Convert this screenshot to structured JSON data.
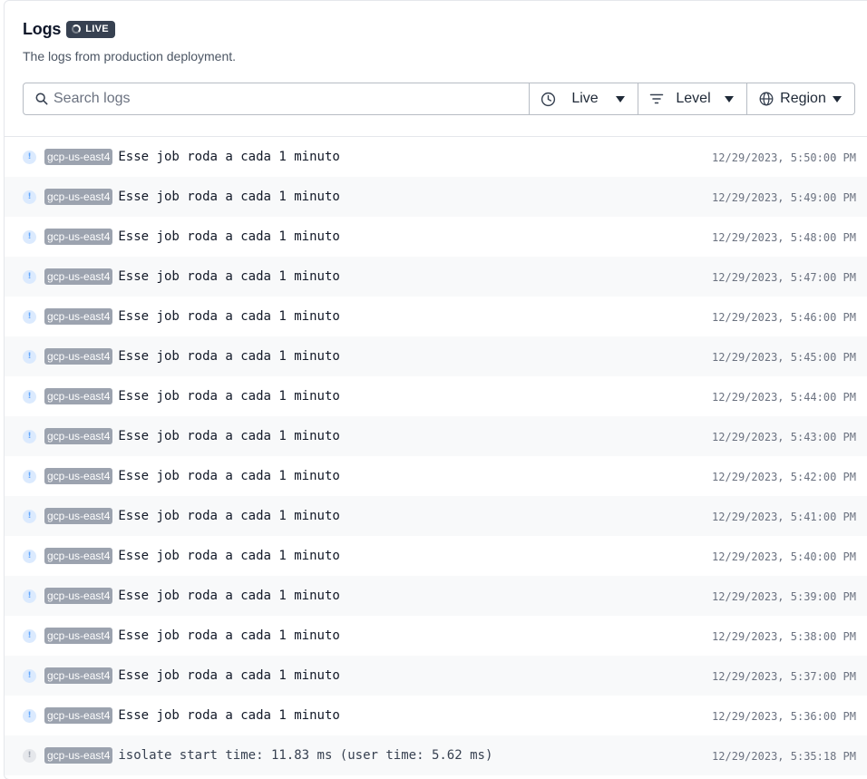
{
  "header": {
    "title": "Logs",
    "badge_label": "LIVE",
    "subtitle": "The logs from production deployment."
  },
  "toolbar": {
    "search_placeholder": "Search logs",
    "live_label": "Live",
    "level_label": "Level",
    "region_label": "Region"
  },
  "logs": [
    {
      "level": "info",
      "region": "gcp-us-east4",
      "message": "Esse job roda a cada 1 minuto",
      "timestamp": "12/29/2023, 5:50:00 PM"
    },
    {
      "level": "info",
      "region": "gcp-us-east4",
      "message": "Esse job roda a cada 1 minuto",
      "timestamp": "12/29/2023, 5:49:00 PM"
    },
    {
      "level": "info",
      "region": "gcp-us-east4",
      "message": "Esse job roda a cada 1 minuto",
      "timestamp": "12/29/2023, 5:48:00 PM"
    },
    {
      "level": "info",
      "region": "gcp-us-east4",
      "message": "Esse job roda a cada 1 minuto",
      "timestamp": "12/29/2023, 5:47:00 PM"
    },
    {
      "level": "info",
      "region": "gcp-us-east4",
      "message": "Esse job roda a cada 1 minuto",
      "timestamp": "12/29/2023, 5:46:00 PM"
    },
    {
      "level": "info",
      "region": "gcp-us-east4",
      "message": "Esse job roda a cada 1 minuto",
      "timestamp": "12/29/2023, 5:45:00 PM"
    },
    {
      "level": "info",
      "region": "gcp-us-east4",
      "message": "Esse job roda a cada 1 minuto",
      "timestamp": "12/29/2023, 5:44:00 PM"
    },
    {
      "level": "info",
      "region": "gcp-us-east4",
      "message": "Esse job roda a cada 1 minuto",
      "timestamp": "12/29/2023, 5:43:00 PM"
    },
    {
      "level": "info",
      "region": "gcp-us-east4",
      "message": "Esse job roda a cada 1 minuto",
      "timestamp": "12/29/2023, 5:42:00 PM"
    },
    {
      "level": "info",
      "region": "gcp-us-east4",
      "message": "Esse job roda a cada 1 minuto",
      "timestamp": "12/29/2023, 5:41:00 PM"
    },
    {
      "level": "info",
      "region": "gcp-us-east4",
      "message": "Esse job roda a cada 1 minuto",
      "timestamp": "12/29/2023, 5:40:00 PM"
    },
    {
      "level": "info",
      "region": "gcp-us-east4",
      "message": "Esse job roda a cada 1 minuto",
      "timestamp": "12/29/2023, 5:39:00 PM"
    },
    {
      "level": "info",
      "region": "gcp-us-east4",
      "message": "Esse job roda a cada 1 minuto",
      "timestamp": "12/29/2023, 5:38:00 PM"
    },
    {
      "level": "info",
      "region": "gcp-us-east4",
      "message": "Esse job roda a cada 1 minuto",
      "timestamp": "12/29/2023, 5:37:00 PM"
    },
    {
      "level": "info",
      "region": "gcp-us-east4",
      "message": "Esse job roda a cada 1 minuto",
      "timestamp": "12/29/2023, 5:36:00 PM"
    },
    {
      "level": "debug",
      "region": "gcp-us-east4",
      "message": "isolate start time: 11.83 ms (user time: 5.62 ms)",
      "timestamp": "12/29/2023, 5:35:18 PM"
    }
  ],
  "level_icon_glyph": "!",
  "colors": {
    "badge_bg": "#374151",
    "region_tag_bg": "#9ca3af",
    "info_icon_bg": "#dbeafe",
    "debug_icon_bg": "#e5e7eb"
  },
  "icons": {
    "search": "search-icon",
    "live": "clock-icon",
    "level": "filter-icon",
    "region": "globe-icon",
    "caret": "caret-down-icon"
  }
}
